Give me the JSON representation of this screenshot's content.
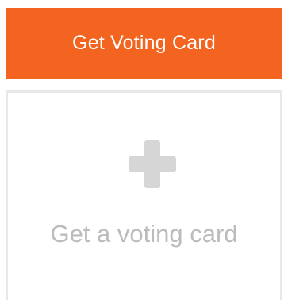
{
  "header": {
    "get_card_button_label": "Get Voting Card"
  },
  "card_slot": {
    "icon": "plus-icon",
    "label": "Get a voting card"
  },
  "colors": {
    "accent": "#F2641F",
    "placeholder_text": "#bcbcbc",
    "placeholder_icon": "#d6d6d6",
    "border": "#e8e8e8"
  }
}
